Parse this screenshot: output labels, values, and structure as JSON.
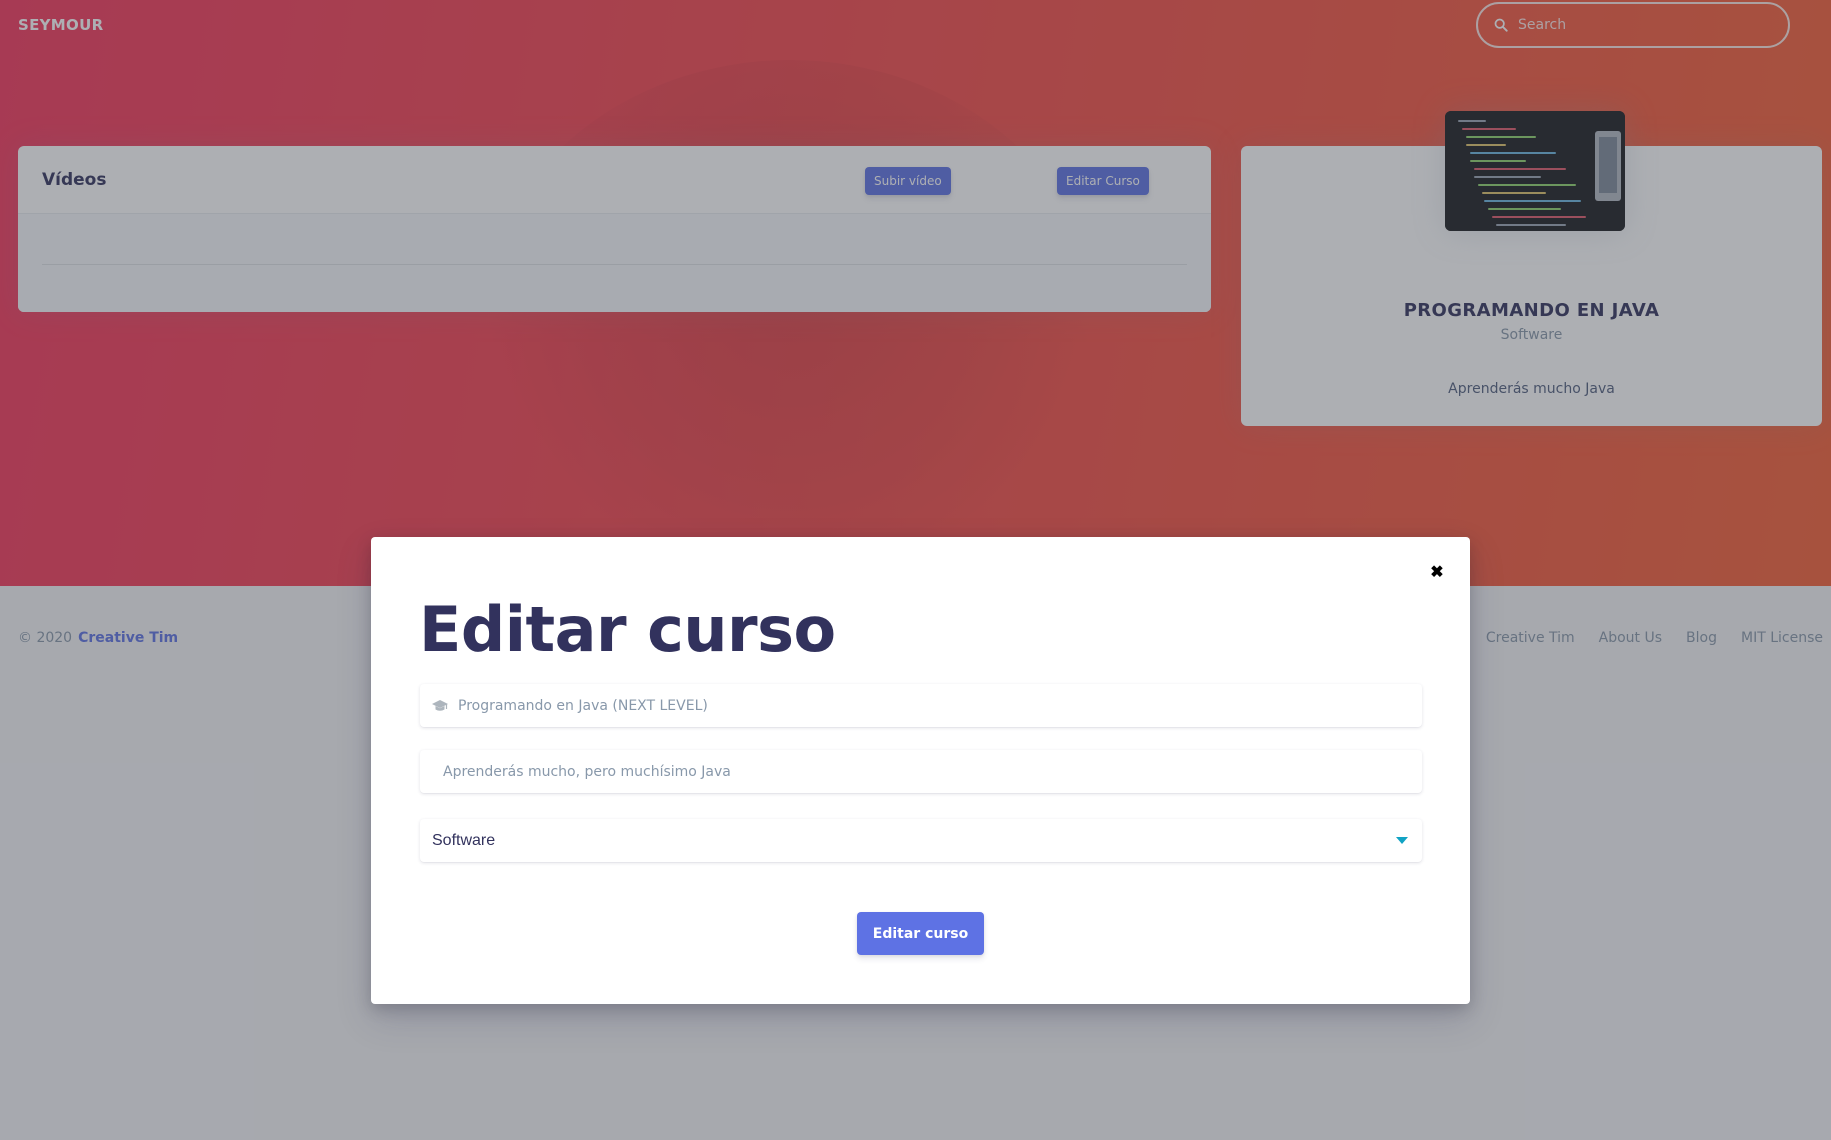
{
  "navbar": {
    "brand": "SEYMOUR",
    "search_placeholder": "Search"
  },
  "videos_card": {
    "title": "Vídeos",
    "upload_button": "Subir vídeo",
    "edit_button": "Editar Curso"
  },
  "course_card": {
    "name": "PROGRAMANDO EN JAVA",
    "category": "Software",
    "description": "Aprenderás mucho Java"
  },
  "footer": {
    "copyright": "© 2020",
    "company": "Creative Tim",
    "links": [
      "Creative Tim",
      "About Us",
      "Blog",
      "MIT License"
    ]
  },
  "modal": {
    "close_symbol": "✖",
    "title": "Editar curso",
    "name_placeholder": "Programando en Java (NEXT LEVEL)",
    "description_placeholder": "Aprenderás mucho, pero muchísimo Java",
    "category_selected": "Software",
    "submit_label": "Editar curso"
  },
  "colors": {
    "hero_gradient_start": "#f5365c",
    "hero_gradient_end": "#f56036",
    "primary": "#5e72e4",
    "heading": "#32325d",
    "muted": "#8898aa",
    "select_caret": "#11a3c4"
  },
  "icons": {
    "search": "search-icon",
    "course_field": "graduation-cap-icon",
    "select_caret": "caret-down-icon",
    "close": "close-icon"
  }
}
